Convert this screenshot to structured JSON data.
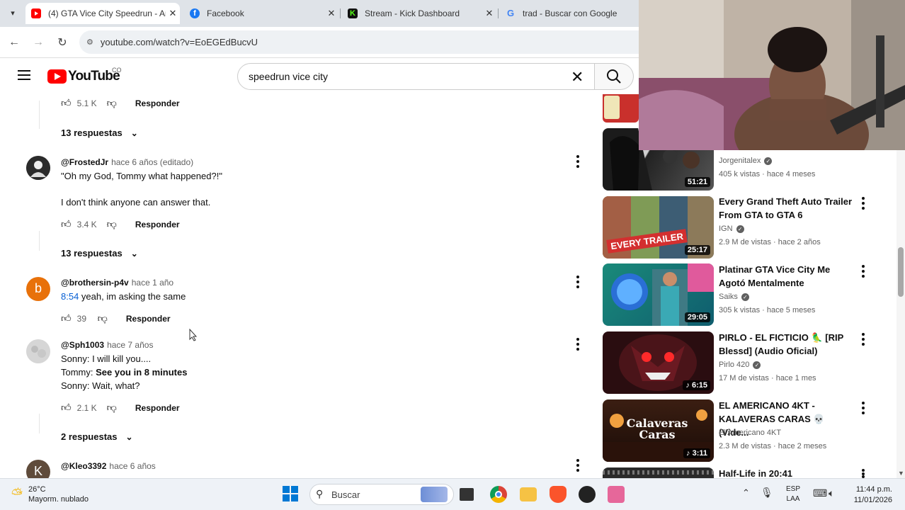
{
  "browser": {
    "tabs": [
      {
        "title": "(4) GTA Vice City Speedrun - An",
        "active": true,
        "icon": "youtube-icon"
      },
      {
        "title": "Facebook",
        "active": false,
        "icon": "facebook-icon"
      },
      {
        "title": "Stream - Kick Dashboard",
        "active": false,
        "icon": "kick-icon"
      },
      {
        "title": "trad - Buscar con Google",
        "active": false,
        "icon": "google-icon"
      }
    ],
    "url": "youtube.com/watch?v=EoEGEdBucvU"
  },
  "youtube": {
    "logo_text": "YouTube",
    "country": "CO",
    "search_query": "speedrun vice city"
  },
  "comments": {
    "top_partial": {
      "likes": "5.1 K",
      "reply_label": "Responder"
    },
    "top_replies": "13 respuestas",
    "items": [
      {
        "author": "@FrostedJr",
        "time": "hace 6 años (editado)",
        "line1": "\"Oh my God, Tommy what happened?!\"",
        "line2": "I don't think anyone can answer that.",
        "likes": "3.4 K",
        "reply_label": "Responder",
        "replies": "13 respuestas"
      },
      {
        "author": "@brothersin-p4v",
        "time": "hace 1 año",
        "avatar_letter": "b",
        "timestamp_link": "8:54",
        "text": " yeah, im asking the same",
        "likes": "39",
        "reply_label": "Responder"
      },
      {
        "author": "@Sph1003",
        "time": "hace 7 años",
        "line1": "Sonny: I will kill you....",
        "line2_prefix": "Tommy:",
        "line2_rest": " See you in 8 minutes",
        "line3": "Sonny: Wait, what?",
        "likes": "2.1 K",
        "reply_label": "Responder",
        "replies": "2 respuestas"
      },
      {
        "author": "@Kleo3392",
        "time": "hace 6 años",
        "avatar_letter": "K"
      }
    ]
  },
  "sidebar": {
    "videos": [
      {
        "title": "",
        "channel": "Jorgenitalex",
        "verified": true,
        "meta": "405 k vistas · hace 4 meses",
        "duration": "51:21"
      },
      {
        "title": "Every Grand Theft Auto Trailer From GTA to GTA 6",
        "channel": "IGN",
        "verified": true,
        "meta": "2.9 M de vistas · hace 2 años",
        "duration": "25:17",
        "thumb_text": "EVERY TRAILER"
      },
      {
        "title": "Platinar GTA Vice City Me Agotó Mentalmente",
        "channel": "Saiks",
        "verified": true,
        "meta": "305 k vistas · hace 5 meses",
        "duration": "29:05"
      },
      {
        "title": "PIRLO - EL FICTICIO 🦜 [RIP Blessd] (Audio Oficial)",
        "channel": "Pirlo 420",
        "verified": true,
        "meta": "17 M de vistas · hace 1 mes",
        "duration": "♪ 6:15"
      },
      {
        "title": "EL AMERICANO 4KT - KALAVERAS CARAS 💀 (Vide...",
        "channel": "El Americano 4KT",
        "verified": false,
        "meta": "2.3 M de vistas · hace 2 meses",
        "duration": "♪ 3:11",
        "thumb_text": "Calaveras Caras"
      },
      {
        "title": "Half-Life in 20:41"
      }
    ]
  },
  "taskbar": {
    "weather_temp": "26°C",
    "weather_desc": "Mayorm. nublado",
    "search_placeholder": "Buscar",
    "lang1": "ESP",
    "lang2": "LAA",
    "time": "11:44 p.m.",
    "date": "11/01/2026"
  },
  "colors": {
    "youtube_red": "#ff0000",
    "link_blue": "#065fd4",
    "taskbar_bg": "#eef2f7"
  }
}
